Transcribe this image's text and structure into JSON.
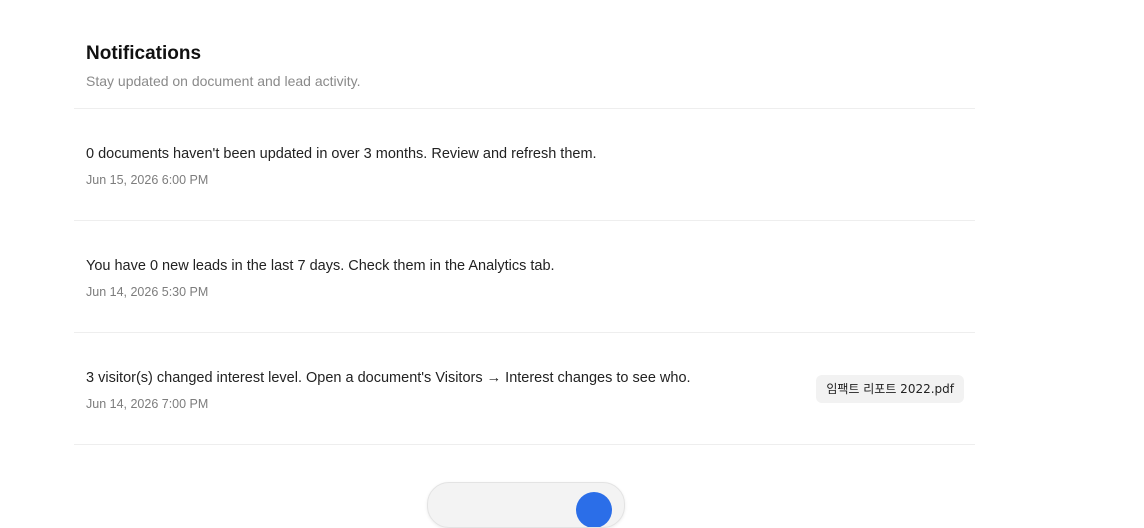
{
  "header": {
    "title": "Notifications",
    "subtitle": "Stay updated on document and lead activity."
  },
  "notifications": [
    {
      "message": "0 documents haven't been updated in over 3 months. Review and refresh them.",
      "time": "Jun 15, 2026 6:00 PM"
    },
    {
      "message": "You have 0 new leads in the last 7 days. Check them in the Analytics tab.",
      "time": "Jun 14, 2026 5:30 PM"
    },
    {
      "message": "3 visitor(s) changed interest level. Open a document's Visitors → Interest changes to see who.",
      "time": "Jun 14, 2026 7:00 PM",
      "document": "임팩트 리포트 2022.pdf"
    }
  ],
  "colors": {
    "accent": "#2b6ee8"
  }
}
